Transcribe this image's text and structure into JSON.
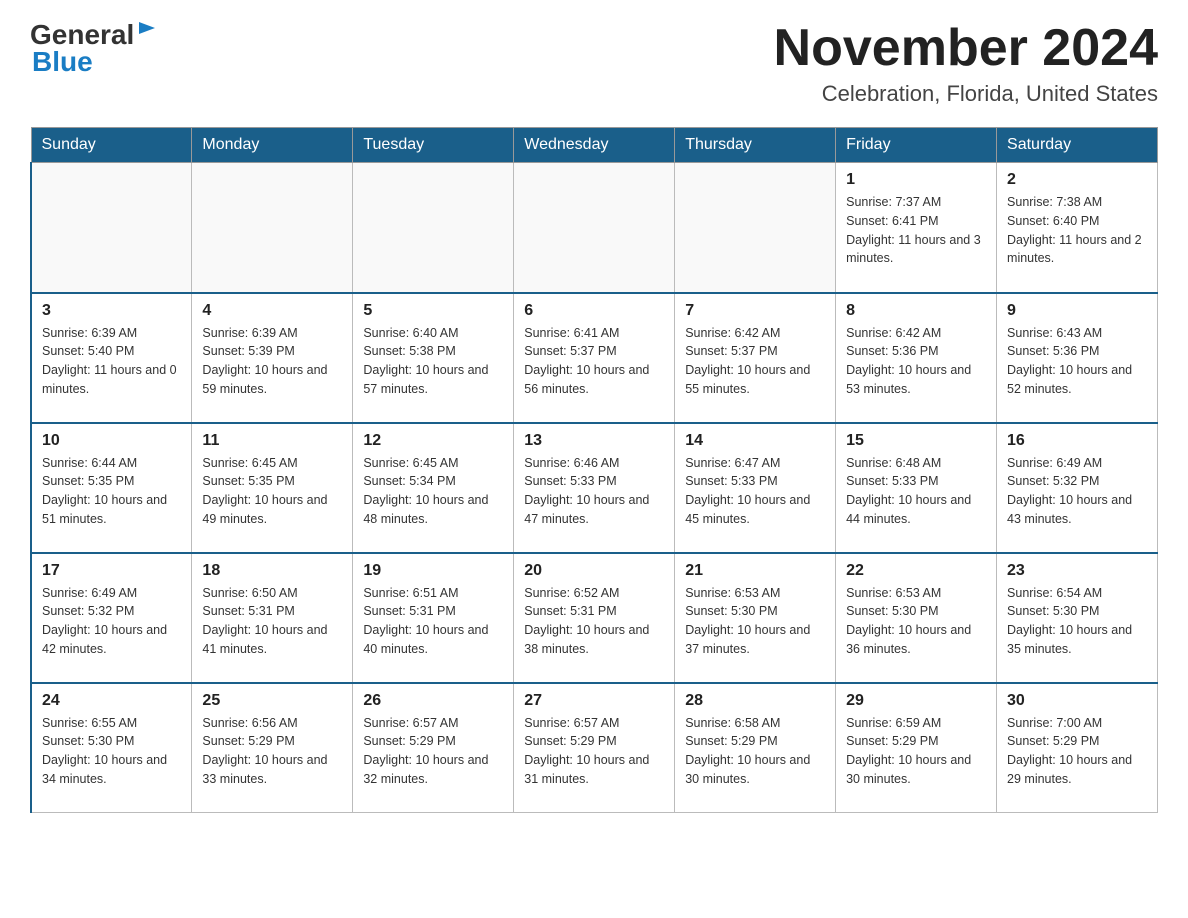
{
  "header": {
    "logo_general": "General",
    "logo_blue": "Blue",
    "title": "November 2024",
    "subtitle": "Celebration, Florida, United States"
  },
  "days_of_week": [
    "Sunday",
    "Monday",
    "Tuesday",
    "Wednesday",
    "Thursday",
    "Friday",
    "Saturday"
  ],
  "weeks": [
    [
      {
        "day": "",
        "info": ""
      },
      {
        "day": "",
        "info": ""
      },
      {
        "day": "",
        "info": ""
      },
      {
        "day": "",
        "info": ""
      },
      {
        "day": "",
        "info": ""
      },
      {
        "day": "1",
        "info": "Sunrise: 7:37 AM\nSunset: 6:41 PM\nDaylight: 11 hours and 3 minutes."
      },
      {
        "day": "2",
        "info": "Sunrise: 7:38 AM\nSunset: 6:40 PM\nDaylight: 11 hours and 2 minutes."
      }
    ],
    [
      {
        "day": "3",
        "info": "Sunrise: 6:39 AM\nSunset: 5:40 PM\nDaylight: 11 hours and 0 minutes."
      },
      {
        "day": "4",
        "info": "Sunrise: 6:39 AM\nSunset: 5:39 PM\nDaylight: 10 hours and 59 minutes."
      },
      {
        "day": "5",
        "info": "Sunrise: 6:40 AM\nSunset: 5:38 PM\nDaylight: 10 hours and 57 minutes."
      },
      {
        "day": "6",
        "info": "Sunrise: 6:41 AM\nSunset: 5:37 PM\nDaylight: 10 hours and 56 minutes."
      },
      {
        "day": "7",
        "info": "Sunrise: 6:42 AM\nSunset: 5:37 PM\nDaylight: 10 hours and 55 minutes."
      },
      {
        "day": "8",
        "info": "Sunrise: 6:42 AM\nSunset: 5:36 PM\nDaylight: 10 hours and 53 minutes."
      },
      {
        "day": "9",
        "info": "Sunrise: 6:43 AM\nSunset: 5:36 PM\nDaylight: 10 hours and 52 minutes."
      }
    ],
    [
      {
        "day": "10",
        "info": "Sunrise: 6:44 AM\nSunset: 5:35 PM\nDaylight: 10 hours and 51 minutes."
      },
      {
        "day": "11",
        "info": "Sunrise: 6:45 AM\nSunset: 5:35 PM\nDaylight: 10 hours and 49 minutes."
      },
      {
        "day": "12",
        "info": "Sunrise: 6:45 AM\nSunset: 5:34 PM\nDaylight: 10 hours and 48 minutes."
      },
      {
        "day": "13",
        "info": "Sunrise: 6:46 AM\nSunset: 5:33 PM\nDaylight: 10 hours and 47 minutes."
      },
      {
        "day": "14",
        "info": "Sunrise: 6:47 AM\nSunset: 5:33 PM\nDaylight: 10 hours and 45 minutes."
      },
      {
        "day": "15",
        "info": "Sunrise: 6:48 AM\nSunset: 5:33 PM\nDaylight: 10 hours and 44 minutes."
      },
      {
        "day": "16",
        "info": "Sunrise: 6:49 AM\nSunset: 5:32 PM\nDaylight: 10 hours and 43 minutes."
      }
    ],
    [
      {
        "day": "17",
        "info": "Sunrise: 6:49 AM\nSunset: 5:32 PM\nDaylight: 10 hours and 42 minutes."
      },
      {
        "day": "18",
        "info": "Sunrise: 6:50 AM\nSunset: 5:31 PM\nDaylight: 10 hours and 41 minutes."
      },
      {
        "day": "19",
        "info": "Sunrise: 6:51 AM\nSunset: 5:31 PM\nDaylight: 10 hours and 40 minutes."
      },
      {
        "day": "20",
        "info": "Sunrise: 6:52 AM\nSunset: 5:31 PM\nDaylight: 10 hours and 38 minutes."
      },
      {
        "day": "21",
        "info": "Sunrise: 6:53 AM\nSunset: 5:30 PM\nDaylight: 10 hours and 37 minutes."
      },
      {
        "day": "22",
        "info": "Sunrise: 6:53 AM\nSunset: 5:30 PM\nDaylight: 10 hours and 36 minutes."
      },
      {
        "day": "23",
        "info": "Sunrise: 6:54 AM\nSunset: 5:30 PM\nDaylight: 10 hours and 35 minutes."
      }
    ],
    [
      {
        "day": "24",
        "info": "Sunrise: 6:55 AM\nSunset: 5:30 PM\nDaylight: 10 hours and 34 minutes."
      },
      {
        "day": "25",
        "info": "Sunrise: 6:56 AM\nSunset: 5:29 PM\nDaylight: 10 hours and 33 minutes."
      },
      {
        "day": "26",
        "info": "Sunrise: 6:57 AM\nSunset: 5:29 PM\nDaylight: 10 hours and 32 minutes."
      },
      {
        "day": "27",
        "info": "Sunrise: 6:57 AM\nSunset: 5:29 PM\nDaylight: 10 hours and 31 minutes."
      },
      {
        "day": "28",
        "info": "Sunrise: 6:58 AM\nSunset: 5:29 PM\nDaylight: 10 hours and 30 minutes."
      },
      {
        "day": "29",
        "info": "Sunrise: 6:59 AM\nSunset: 5:29 PM\nDaylight: 10 hours and 30 minutes."
      },
      {
        "day": "30",
        "info": "Sunrise: 7:00 AM\nSunset: 5:29 PM\nDaylight: 10 hours and 29 minutes."
      }
    ]
  ]
}
